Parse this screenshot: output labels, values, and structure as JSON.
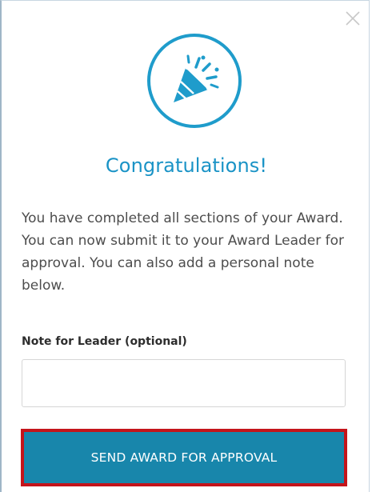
{
  "dialog": {
    "title": "Congratulations!",
    "message": "You have completed all sections of your Award. You can now submit it to your Award Leader for approval. You can also add a personal note below.",
    "icon": "party-popper-icon",
    "close_icon": "close-icon"
  },
  "note": {
    "label": "Note for Leader (optional)",
    "value": "",
    "placeholder": ""
  },
  "submit": {
    "label": "SEND AWARD FOR APPROVAL"
  },
  "colors": {
    "accent": "#1a93c6",
    "button": "#1886ab",
    "highlight_border": "#c4141b"
  }
}
